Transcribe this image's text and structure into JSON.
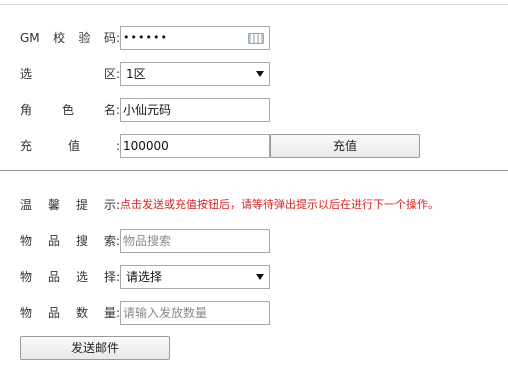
{
  "top_form": {
    "gm_code": {
      "label_chars": [
        "GM",
        "校",
        "验",
        "码"
      ],
      "value": "••••••"
    },
    "region": {
      "label_chars": [
        "选",
        "区"
      ],
      "selected": "1区"
    },
    "role": {
      "label_chars": [
        "角",
        "色",
        "名"
      ],
      "value": "小仙元码"
    },
    "recharge": {
      "label_chars": [
        "充",
        "值"
      ],
      "value": "100000",
      "button": "充值"
    }
  },
  "mail_form": {
    "tip": {
      "label_chars": [
        "温",
        "馨",
        "提",
        "示"
      ],
      "text": "点击发送或充值按钮后，请等待弹出提示以后在进行下一个操作。"
    },
    "item_search": {
      "label_chars": [
        "物",
        "品",
        "搜",
        "索"
      ],
      "placeholder": "物品搜索"
    },
    "item_select": {
      "label_chars": [
        "物",
        "品",
        "选",
        "择"
      ],
      "selected": "请选择"
    },
    "item_qty": {
      "label_chars": [
        "物",
        "品",
        "数",
        "量"
      ],
      "placeholder": "请输入发放数量"
    },
    "send_button": "发送邮件"
  },
  "colon": ":",
  "colors": {
    "tip_text": "#e02020",
    "divider": "#9a9a9a"
  }
}
